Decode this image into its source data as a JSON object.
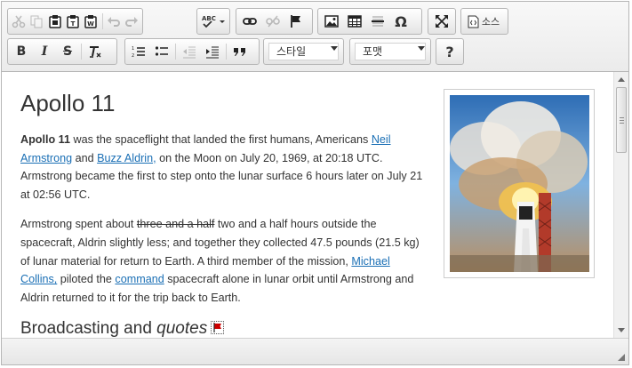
{
  "toolbar": {
    "source_label": "소스",
    "styles_label": "스타일",
    "format_label": "포맷",
    "help_label": "?",
    "bold_label": "B",
    "italic_label": "I",
    "strike_label": "S",
    "special_char_label": "Ω",
    "blockquote_label": "99",
    "spellcheck_label": "ABC"
  },
  "document": {
    "title": "Apollo 11",
    "p1": {
      "bold": "Apollo 11",
      "t1": " was the spaceflight that landed the first humans, Americans ",
      "link1": "Neil Armstrong",
      "t2": " and ",
      "link2": "Buzz Aldrin,",
      "t3": " on the Moon on July 20, 1969, at 20:18 UTC. Armstrong became the first to step onto the lunar surface 6 hours later on July 21 at 02:56 UTC."
    },
    "p2": {
      "t1": "Armstrong spent about ",
      "strike": "three and a half",
      "t2": " two and a half hours outside the spacecraft, Aldrin slightly less; and together they collected 47.5 pounds (21.5 kg) of lunar material for return to Earth. A third member of the mission, ",
      "link1": "Michael Collins,",
      "t3": " piloted the ",
      "link2": "command",
      "t4": " spacecraft alone in lunar orbit until Armstrong and Aldrin returned to it for the trip back to Earth."
    },
    "h2": {
      "t1": "Broadcasting and ",
      "italic": "quotes"
    }
  },
  "colors": {
    "link": "#1a6fb5",
    "anchor_flag": "#cc0000"
  },
  "icons": [
    "cut-icon",
    "copy-icon",
    "paste-icon",
    "paste-text-icon",
    "paste-word-icon",
    "undo-icon",
    "redo-icon",
    "spellcheck-icon",
    "link-icon",
    "unlink-icon",
    "anchor-icon",
    "image-icon",
    "table-icon",
    "horizontal-line-icon",
    "special-char-icon",
    "maximize-icon",
    "source-icon",
    "bold-icon",
    "italic-icon",
    "strike-icon",
    "remove-format-icon",
    "numbered-list-icon",
    "bulleted-list-icon",
    "outdent-icon",
    "indent-icon",
    "blockquote-icon",
    "help-icon"
  ]
}
